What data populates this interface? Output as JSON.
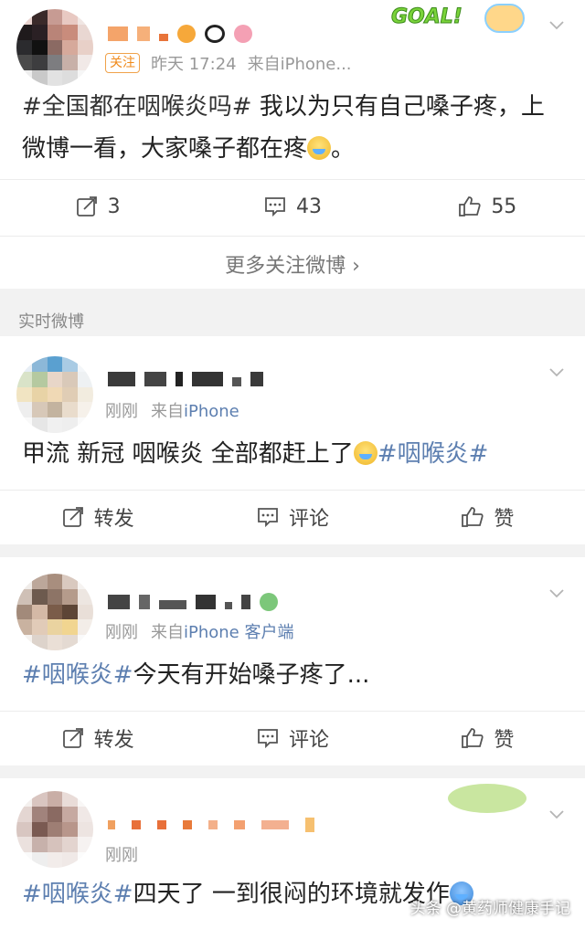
{
  "post1": {
    "badge": "关注",
    "time": "昨天 17:24",
    "source": "来自iPhone...",
    "topic": "#全国都在咽喉炎吗#",
    "text": " 我以为只有自己嗓子疼，上微博一看，大家嗓子都在疼",
    "text_end": "。",
    "repost_count": "3",
    "comment_count": "43",
    "like_count": "55",
    "goal_sticker": "GOAL!"
  },
  "more_link": "更多关注微博 ›",
  "section_label": "实时微博",
  "post2": {
    "time": "刚刚",
    "source_prefix": "来自",
    "source": "iPhone",
    "text": "甲流 新冠 咽喉炎 全部都赶上了",
    "topic": "#咽喉炎#",
    "repost_label": "转发",
    "comment_label": "评论",
    "like_label": "赞"
  },
  "post3": {
    "time": "刚刚",
    "source_prefix": "来自",
    "source": "iPhone 客户端",
    "topic": "#咽喉炎#",
    "text": "今天有开始嗓子疼了...",
    "repost_label": "转发",
    "comment_label": "评论",
    "like_label": "赞"
  },
  "post4": {
    "time": "刚刚",
    "topic": "#咽喉炎#",
    "text": "四天了 一到很闷的环境就发作"
  },
  "watermark": "头条 @黄药师健康手记",
  "colors": {
    "topic_blue": "#5d7fb0",
    "badge_orange": "#f08a1a",
    "background": "#f2f2f2"
  }
}
